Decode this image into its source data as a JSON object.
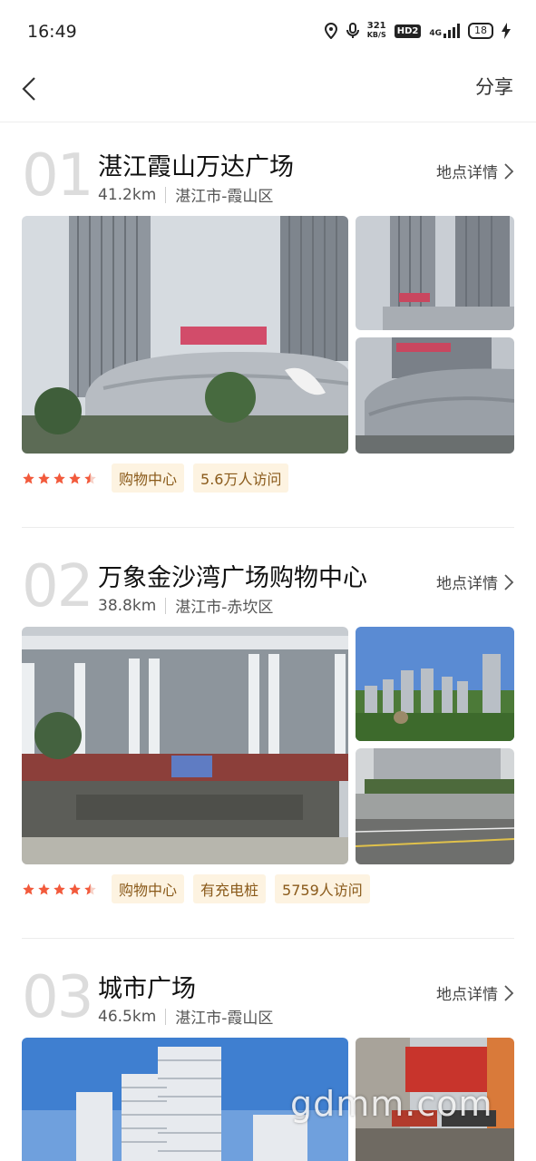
{
  "status_bar": {
    "time": "16:49",
    "net_speed_value": "321",
    "net_speed_unit": "KB/S",
    "hd_label": "HD2",
    "network": "4G",
    "battery": "18"
  },
  "nav": {
    "back_icon": "chevron-left-icon",
    "share_label": "分享"
  },
  "places": [
    {
      "number": "01",
      "name": "湛江霞山万达广场",
      "distance": "41.2km",
      "area": "湛江市-霞山区",
      "detail_label": "地点详情",
      "rating": 4.5,
      "tags": [
        "购物中心",
        "5.6万人访问"
      ]
    },
    {
      "number": "02",
      "name": "万象金沙湾广场购物中心",
      "distance": "38.8km",
      "area": "湛江市-赤坎区",
      "detail_label": "地点详情",
      "rating": 4.5,
      "tags": [
        "购物中心",
        "有充电桩",
        "5759人访问"
      ]
    },
    {
      "number": "03",
      "name": "城市广场",
      "distance": "46.5km",
      "area": "湛江市-霞山区",
      "detail_label": "地点详情"
    }
  ],
  "watermark": "gdmm.com",
  "colors": {
    "star": "#f25a3c",
    "tag_bg": "#fdf3e1",
    "tag_text": "#8a5a1a",
    "number": "#dcdcdc"
  }
}
